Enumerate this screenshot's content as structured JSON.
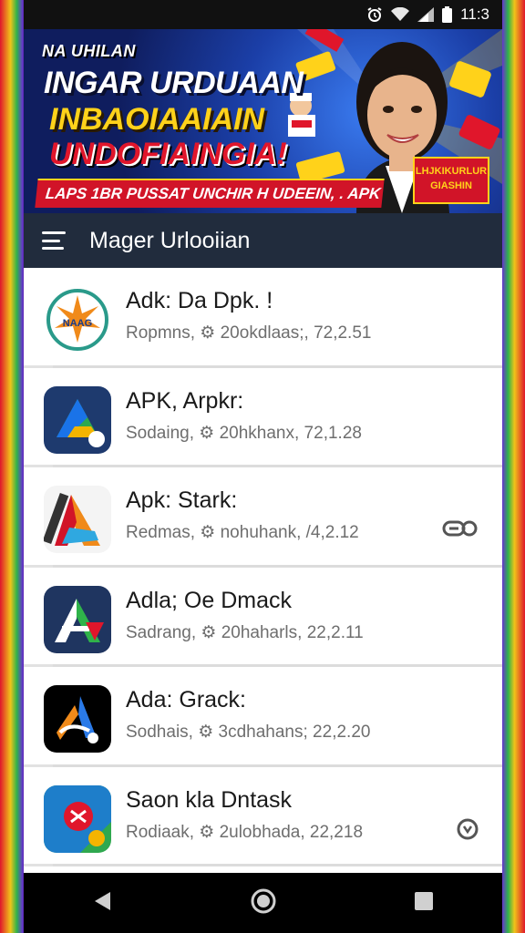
{
  "status_bar": {
    "time": "11:3",
    "icons": [
      "alarm-icon",
      "wifi-icon",
      "signal-icon",
      "battery-icon"
    ]
  },
  "banner": {
    "line1": "NA UHILAN",
    "line2": "INGAR URDUAAN",
    "line3": "INBAOIAAIAIN",
    "line4": "UNDOFIAINGIA!",
    "strip": "LAPS 1BR PUSSAT UNCHIR H UDEEIN, . APK",
    "badge": "LHJKIKURLUR GIASHIN"
  },
  "app_bar": {
    "title": "Mager Urlooiian"
  },
  "apps": [
    {
      "title": "Adk: Da Dpk. !",
      "subtitle": "Ropmns, ⚙ 20okdlaas;, 72,2.51",
      "icon": "sunburst-logo-icon",
      "trailing": ""
    },
    {
      "title": "APK, Arpkr:",
      "subtitle": "Sodaing, ⚙ 20hkhanx, 72,1.28",
      "icon": "triangle-drive-icon",
      "trailing": ""
    },
    {
      "title": "Apk: Stark:",
      "subtitle": "Redmas, ⚙ nohuhank, /4,2.12",
      "icon": "colorful-a-icon",
      "trailing": "link-icon"
    },
    {
      "title": "Adla; Oe Dmack",
      "subtitle": "Sadrang, ⚙ 20haharls, 22,2.11",
      "icon": "green-a-icon",
      "trailing": ""
    },
    {
      "title": "Ada: Grack:",
      "subtitle": "Sodhais, ⚙ 3cdhahans; 22,2.20",
      "icon": "black-orange-a-icon",
      "trailing": ""
    },
    {
      "title": "Saon kla Dntask",
      "subtitle": "Rodiaak, ⚙ 2ulobhada, 22,218",
      "icon": "map-pin-icon",
      "trailing": "clock-icon"
    }
  ],
  "nav_bar": {
    "buttons": [
      "back-icon",
      "home-icon",
      "recents-icon"
    ]
  }
}
